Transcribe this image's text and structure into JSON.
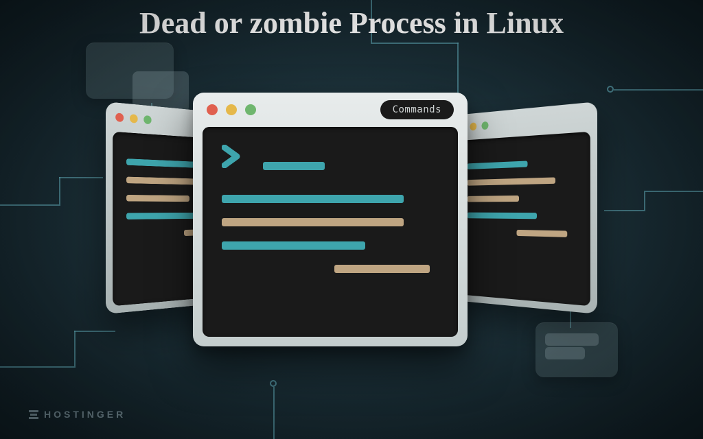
{
  "title": "Dead or zombie Process in Linux",
  "terminal": {
    "badge": "Commands"
  },
  "brand": "HOSTINGER",
  "colors": {
    "teal": "#3ea5ad",
    "tan": "#bfa582",
    "red": "#e0604f",
    "yellow": "#e5b84a",
    "green": "#6fb66e"
  }
}
